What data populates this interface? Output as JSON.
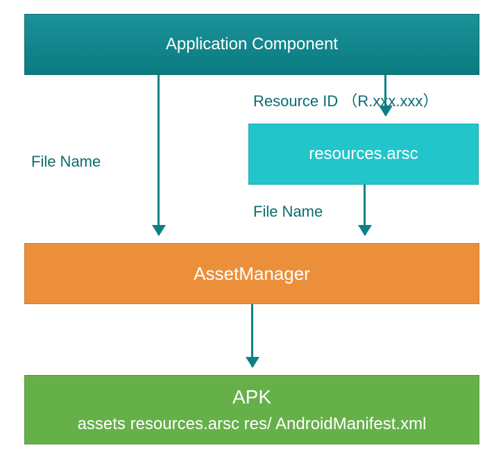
{
  "boxes": {
    "app_component": "Application Component",
    "resources_arsc": "resources.arsc",
    "asset_manager": "AssetManager",
    "apk_title": "APK",
    "apk_sub": "assets resources.arsc res/ AndroidManifest.xml"
  },
  "labels": {
    "resource_id": "Resource ID （R.xxx.xxx）",
    "file_name_1": "File Name",
    "file_name_2": "File Name"
  }
}
